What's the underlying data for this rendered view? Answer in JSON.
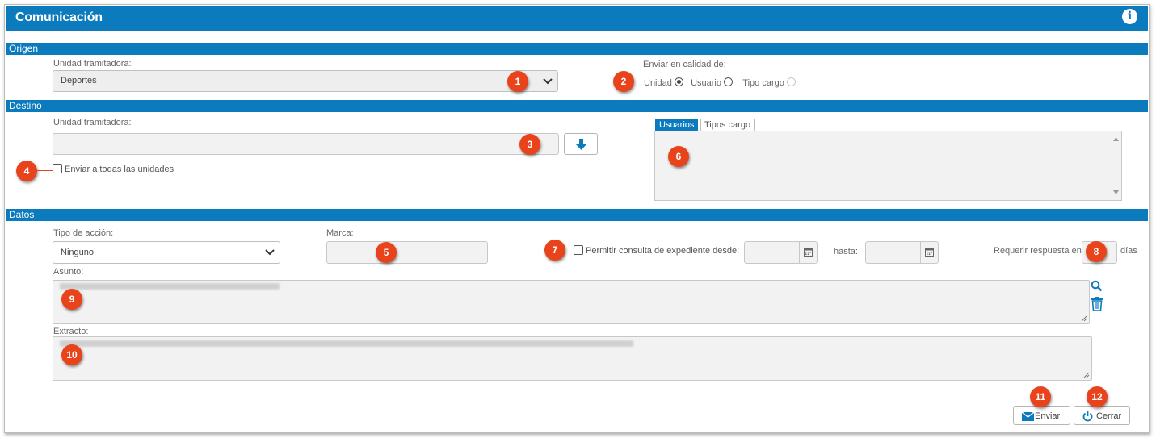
{
  "window": {
    "title": "Comunicación",
    "info_icon": "info-icon"
  },
  "sections": {
    "origen": "Origen",
    "destino": "Destino",
    "datos": "Datos"
  },
  "origen": {
    "unidad_label": "Unidad tramitadora:",
    "unidad_value": "Deportes",
    "enviar_label": "Enviar en calidad de:",
    "options": [
      {
        "label": "Unidad",
        "selected": true,
        "disabled": false
      },
      {
        "label": "Usuario",
        "selected": false,
        "disabled": false
      },
      {
        "label": "Tipo cargo",
        "selected": false,
        "disabled": true
      }
    ]
  },
  "destino": {
    "unidad_label": "Unidad tramitadora:",
    "unidad_value": "",
    "enviar_todas_label": "Enviar a todas las unidades",
    "tabs": [
      {
        "label": "Usuarios",
        "active": true
      },
      {
        "label": "Tipos cargo",
        "active": false
      }
    ]
  },
  "datos": {
    "tipo_accion_label": "Tipo de acción:",
    "tipo_accion_value": "Ninguno",
    "marca_label": "Marca:",
    "permitir_label": "Permitir consulta de expediente desde:",
    "hasta_label": "hasta:",
    "requerir_label": "Requerir respuesta en",
    "dias_label": "días",
    "asunto_label": "Asunto:",
    "extracto_label": "Extracto:"
  },
  "actions": {
    "enviar": "Enviar",
    "cerrar": "Cerrar"
  },
  "badges": [
    "1",
    "2",
    "3",
    "4",
    "5",
    "6",
    "7",
    "8",
    "9",
    "10",
    "11",
    "12"
  ],
  "colors": {
    "header": "#0c7bbd",
    "badge": "#e8431b"
  }
}
